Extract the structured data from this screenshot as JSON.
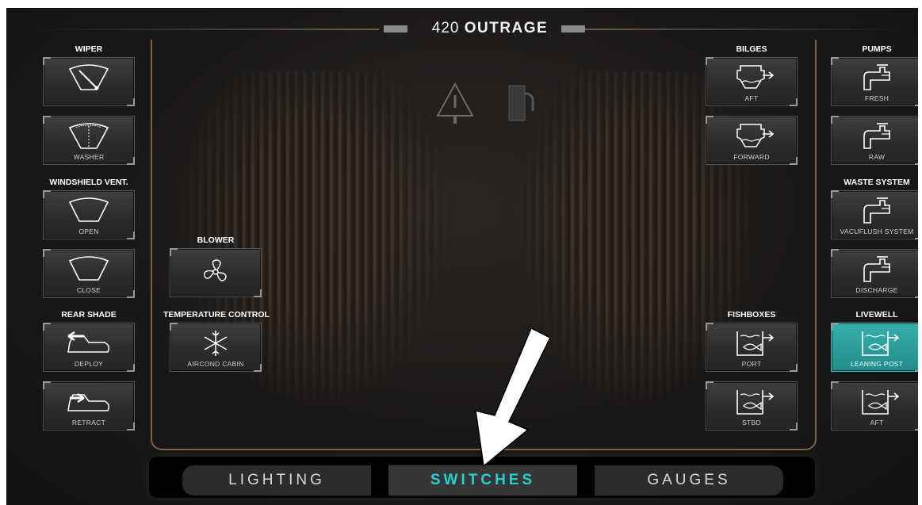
{
  "header": {
    "title_number": "420",
    "title_name": "OUTRAGE"
  },
  "left_column": {
    "wiper": {
      "label": "WIPER",
      "buttons": [
        {
          "label": ""
        },
        {
          "label": "WASHER"
        }
      ]
    },
    "windshield_vent": {
      "label": "WINDSHIELD VENT.",
      "buttons": [
        {
          "label": "OPEN"
        },
        {
          "label": "CLOSE"
        }
      ]
    },
    "rear_shade": {
      "label": "REAR SHADE",
      "buttons": [
        {
          "label": "DEPLOY"
        },
        {
          "label": "RETRACT"
        }
      ]
    }
  },
  "inner_left": {
    "blower": {
      "label": "BLOWER",
      "button_label": ""
    },
    "temperature_control": {
      "label": "TEMPERATURE CONTROL",
      "button_label": "AIRCOND CABIN"
    }
  },
  "inner_right": {
    "bilges": {
      "label": "BILGES",
      "buttons": [
        {
          "label": "AFT"
        },
        {
          "label": "FORWARD"
        }
      ]
    },
    "fishboxes": {
      "label": "FISHBOXES",
      "buttons": [
        {
          "label": "PORT"
        },
        {
          "label": "STBD"
        }
      ]
    }
  },
  "right_column": {
    "pumps": {
      "label": "PUMPS",
      "buttons": [
        {
          "label": "FRESH"
        },
        {
          "label": "RAW"
        }
      ]
    },
    "waste_system": {
      "label": "WASTE SYSTEM",
      "buttons": [
        {
          "label": "VACUFLUSH SYSTEM"
        },
        {
          "label": "DISCHARGE"
        }
      ]
    },
    "livewell": {
      "label": "LIVEWELL",
      "buttons": [
        {
          "label": "LEANING POST",
          "active": true
        },
        {
          "label": "AFT"
        }
      ]
    }
  },
  "center_icons": [
    "warning-triangle-icon",
    "fuel-pump-icon"
  ],
  "nav": {
    "tabs": [
      {
        "label": "LIGHTING"
      },
      {
        "label": "SWITCHES",
        "active": true
      },
      {
        "label": "GAUGES"
      }
    ]
  },
  "colors": {
    "accent": "#25d0d0",
    "active_button": "#2a9c9a",
    "frame": "#7a6450",
    "background": "#1a1817"
  }
}
